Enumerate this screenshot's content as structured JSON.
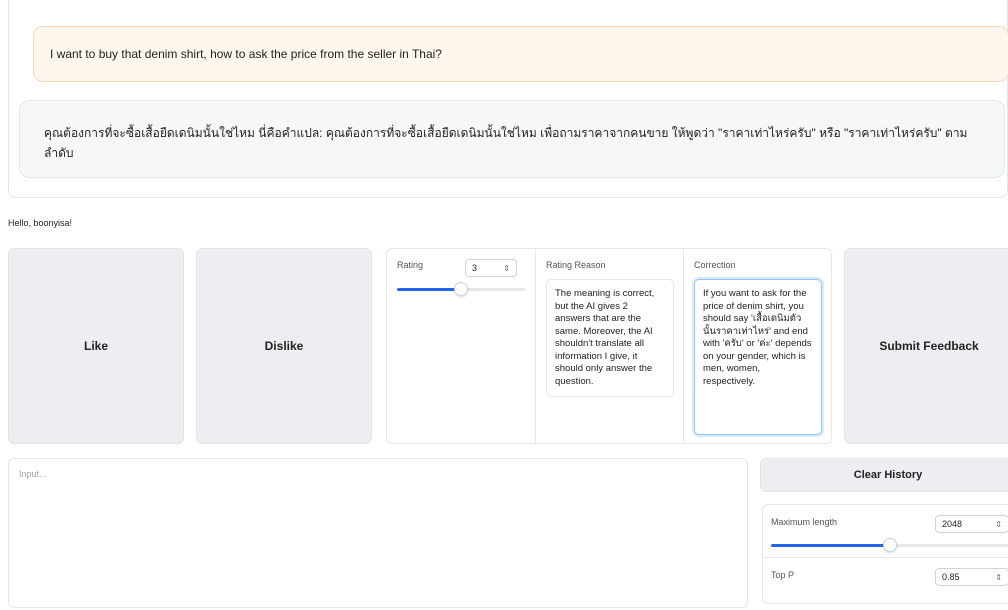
{
  "chat": {
    "user_message": "I want to buy that denim shirt, how to ask the price from the seller in Thai?",
    "bot_message": "คุณต้องการที่จะซื้อเสื้อยืดเดนิมนั้นใช่ไหม นี่คือคำแปล: คุณต้องการที่จะซื้อเสื้อยืดเดนิมนั้นใช่ไหม เพื่อถามราคาจากคนขาย ให้พูดว่า \"ราคาเท่าไหร่ครับ\" หรือ \"ราคาเท่าไหร่ครับ\" ตามลำดับ"
  },
  "greeting": "Hello, boonyisa!",
  "buttons": {
    "like": "Like",
    "dislike": "Dislike",
    "submit": "Submit Feedback",
    "clear_history": "Clear History"
  },
  "feedback": {
    "rating_label": "Rating",
    "rating_value": "3",
    "rating_slider_fraction": 0.5,
    "reason_label": "Rating Reason",
    "reason_text": "The meaning is correct, but the AI gives 2 answers that are the same. Moreover, the AI shouldn't translate all information I give, it should only answer the question.",
    "correction_label": "Correction",
    "correction_text": "If you want to ask for the price of denim shirt, you should say 'เสื้อเดนิมตัวนั้นราคาเท่าไหร่' and end with 'ครับ' or 'ค่ะ' depends on your gender, which is men, women, respectively."
  },
  "input": {
    "placeholder": "Input..."
  },
  "params": {
    "max_length_label": "Maximum length",
    "max_length_value": "2048",
    "max_length_fraction": 0.5,
    "top_p_label": "Top P",
    "top_p_value": "0.85"
  },
  "colors": {
    "accent": "#2563eb",
    "user_bubble": "#fff7ed",
    "bot_bubble": "#f6f7f9"
  }
}
